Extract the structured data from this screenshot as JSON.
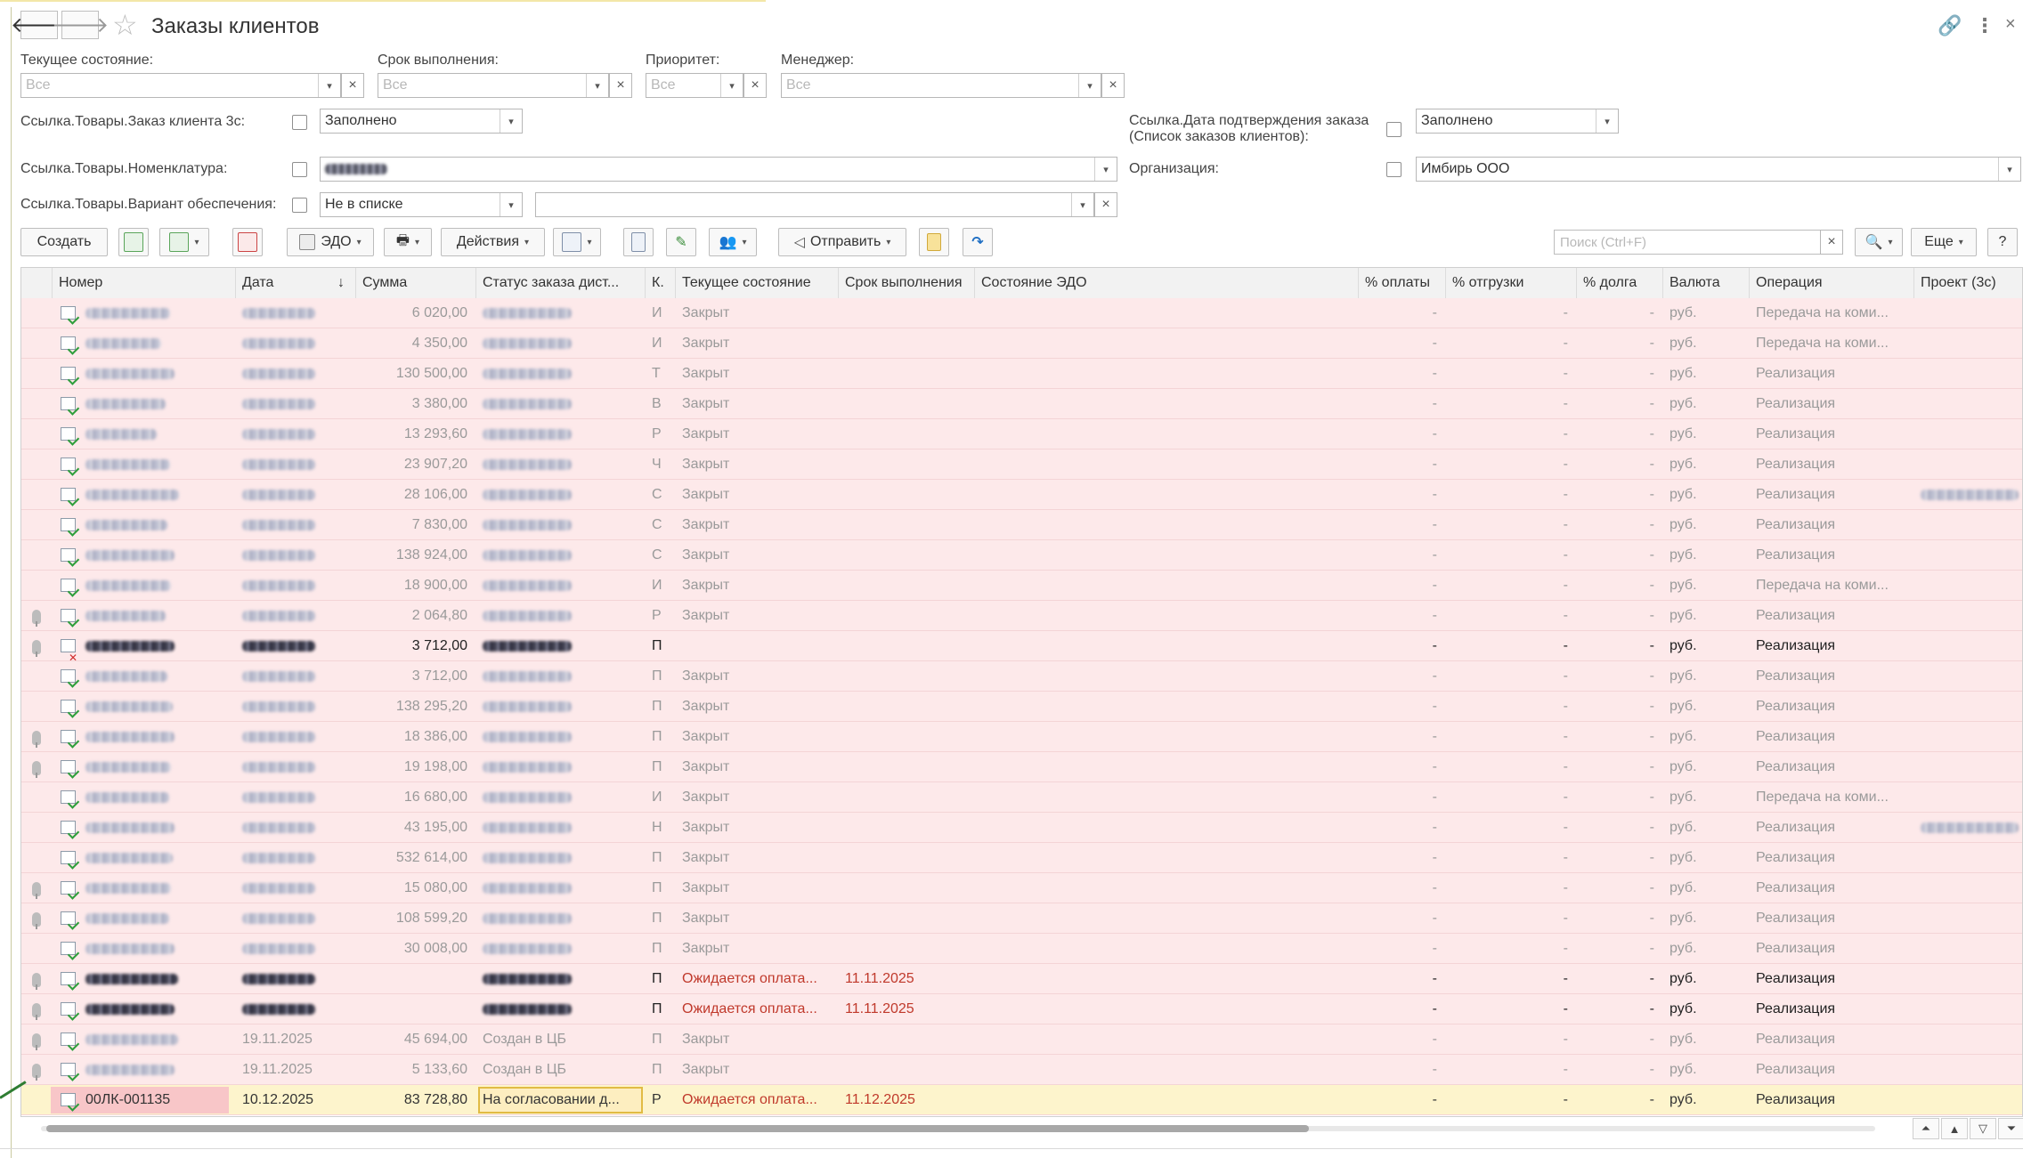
{
  "window": {
    "title": "Заказы клиентов",
    "back_icon": "arrow-left-icon",
    "forward_icon": "arrow-right-icon",
    "favorite_icon": "star-icon",
    "link_icon": "link-icon",
    "menu_icon": "more-vertical-icon",
    "close_label": "×"
  },
  "filters": {
    "current_state": {
      "label": "Текущее состояние:",
      "placeholder": "Все"
    },
    "deadline": {
      "label": "Срок выполнения:",
      "placeholder": "Все"
    },
    "priority": {
      "label": "Приоритет:",
      "placeholder": "Все"
    },
    "manager": {
      "label": "Менеджер:",
      "placeholder": "Все"
    },
    "order3c": {
      "label": "Ссылка.Товары.Заказ клиента 3с:",
      "value": "Заполнено"
    },
    "confirm_date": {
      "label_line1": "Ссылка.Дата подтверждения заказа",
      "label_line2": "(Список заказов клиентов):",
      "value": "Заполнено"
    },
    "nomenclature": {
      "label": "Ссылка.Товары.Номенклатура:"
    },
    "organization": {
      "label": "Организация:",
      "value": "Имбирь ООО"
    },
    "variant": {
      "label": "Ссылка.Товары.Вариант обеспечения:",
      "value": "Не в списке"
    },
    "clear_label": "×"
  },
  "toolbar": {
    "create": "Создать",
    "edo": "ЭДО",
    "actions": "Действия",
    "send": "Отправить",
    "search_placeholder": "Поиск (Ctrl+F)",
    "more": "Еще",
    "help": "?",
    "sort_arrow": "↓",
    "clear_label": "×"
  },
  "table": {
    "columns": [
      "Номер",
      "Дата",
      "Сумма",
      "Статус заказа дист...",
      "К.",
      "Текущее состояние",
      "Срок выполнения",
      "Состояние ЭДО",
      "% оплаты",
      "% отгрузки",
      "% долга",
      "Валюта",
      "Операция",
      "Проект (3с)"
    ],
    "rows": [
      {
        "sum": "6 020,00",
        "k": "И",
        "state": "Закрыт",
        "deadline": "",
        "op": "Передача на коми...",
        "style": "dim",
        "pin": false,
        "icon": "doc-check",
        "project": false
      },
      {
        "sum": "4 350,00",
        "k": "И",
        "state": "Закрыт",
        "deadline": "",
        "op": "Передача на коми...",
        "style": "dim",
        "pin": false,
        "icon": "doc-check",
        "project": false
      },
      {
        "sum": "130 500,00",
        "k": "Т",
        "state": "Закрыт",
        "deadline": "",
        "op": "Реализация",
        "style": "dim",
        "pin": false,
        "icon": "doc-check",
        "project": false
      },
      {
        "sum": "3 380,00",
        "k": "В",
        "state": "Закрыт",
        "deadline": "",
        "op": "Реализация",
        "style": "dim",
        "pin": false,
        "icon": "doc-check",
        "project": false
      },
      {
        "sum": "13 293,60",
        "k": "Р",
        "state": "Закрыт",
        "deadline": "",
        "op": "Реализация",
        "style": "dim",
        "pin": false,
        "icon": "doc-check",
        "project": false
      },
      {
        "sum": "23 907,20",
        "k": "Ч",
        "state": "Закрыт",
        "deadline": "",
        "op": "Реализация",
        "style": "dim",
        "pin": false,
        "icon": "doc-check",
        "project": false
      },
      {
        "sum": "28 106,00",
        "k": "С",
        "state": "Закрыт",
        "deadline": "",
        "op": "Реализация",
        "style": "dim",
        "pin": false,
        "icon": "doc-check",
        "project": true
      },
      {
        "sum": "7 830,00",
        "k": "С",
        "state": "Закрыт",
        "deadline": "",
        "op": "Реализация",
        "style": "dim",
        "pin": false,
        "icon": "doc-check",
        "project": false
      },
      {
        "sum": "138 924,00",
        "k": "С",
        "state": "Закрыт",
        "deadline": "",
        "op": "Реализация",
        "style": "dim",
        "pin": false,
        "icon": "doc-check",
        "project": false
      },
      {
        "sum": "18 900,00",
        "k": "И",
        "state": "Закрыт",
        "deadline": "",
        "op": "Передача на коми...",
        "style": "dim",
        "pin": false,
        "icon": "doc-check",
        "project": false
      },
      {
        "sum": "2 064,80",
        "k": "Р",
        "state": "Закрыт",
        "deadline": "",
        "op": "Реализация",
        "style": "dim",
        "pin": true,
        "icon": "doc-check",
        "project": false
      },
      {
        "sum": "3 712,00",
        "k": "П",
        "state": "",
        "deadline": "",
        "op": "Реализация",
        "style": "bold",
        "pin": true,
        "icon": "doc-x",
        "project": false
      },
      {
        "sum": "3 712,00",
        "k": "П",
        "state": "Закрыт",
        "deadline": "",
        "op": "Реализация",
        "style": "dim",
        "pin": false,
        "icon": "doc-check",
        "project": false
      },
      {
        "sum": "138 295,20",
        "k": "П",
        "state": "Закрыт",
        "deadline": "",
        "op": "Реализация",
        "style": "dim",
        "pin": false,
        "icon": "doc-check",
        "project": false
      },
      {
        "sum": "18 386,00",
        "k": "П",
        "state": "Закрыт",
        "deadline": "",
        "op": "Реализация",
        "style": "dim",
        "pin": true,
        "icon": "doc-check",
        "project": false
      },
      {
        "sum": "19 198,00",
        "k": "П",
        "state": "Закрыт",
        "deadline": "",
        "op": "Реализация",
        "style": "dim",
        "pin": true,
        "icon": "doc-check",
        "project": false
      },
      {
        "sum": "16 680,00",
        "k": "И",
        "state": "Закрыт",
        "deadline": "",
        "op": "Передача на коми...",
        "style": "dim",
        "pin": false,
        "icon": "doc-check",
        "project": false
      },
      {
        "sum": "43 195,00",
        "k": "Н",
        "state": "Закрыт",
        "deadline": "",
        "op": "Реализация",
        "style": "dim",
        "pin": false,
        "icon": "doc-check",
        "project": true
      },
      {
        "sum": "532 614,00",
        "k": "П",
        "state": "Закрыт",
        "deadline": "",
        "op": "Реализация",
        "style": "dim",
        "pin": false,
        "icon": "doc-check",
        "project": false
      },
      {
        "sum": "15 080,00",
        "k": "П",
        "state": "Закрыт",
        "deadline": "",
        "op": "Реализация",
        "style": "dim",
        "pin": true,
        "icon": "doc-check",
        "project": false
      },
      {
        "sum": "108 599,20",
        "k": "П",
        "state": "Закрыт",
        "deadline": "",
        "op": "Реализация",
        "style": "dim",
        "pin": true,
        "icon": "doc-check",
        "project": false
      },
      {
        "sum": "30 008,00",
        "k": "П",
        "state": "Закрыт",
        "deadline": "",
        "op": "Реализация",
        "style": "dim",
        "pin": false,
        "icon": "doc-check",
        "project": false
      },
      {
        "sum": "",
        "k": "П",
        "state": "Ожидается оплата...",
        "deadline": "11.11.2025",
        "op": "Реализация",
        "style": "bold",
        "pin": true,
        "icon": "doc-check",
        "project": false
      },
      {
        "sum": "",
        "k": "П",
        "state": "Ожидается оплата...",
        "deadline": "11.11.2025",
        "op": "Реализация",
        "style": "bold",
        "pin": true,
        "icon": "doc-check",
        "project": false
      },
      {
        "sum": "45 694,00",
        "k": "П",
        "state": "Закрыт",
        "deadline": "",
        "op": "Реализация",
        "style": "dim",
        "pin": true,
        "icon": "doc-check",
        "project": false,
        "date": "19.11.2025",
        "status": "Создан в ЦБ"
      },
      {
        "sum": "5 133,60",
        "k": "П",
        "state": "Закрыт",
        "deadline": "",
        "op": "Реализация",
        "style": "dim",
        "pin": true,
        "icon": "doc-check",
        "project": false,
        "date": "19.11.2025",
        "status": "Создан в ЦБ"
      },
      {
        "sum": "83 728,80",
        "k": "Р",
        "state": "Ожидается оплата...",
        "deadline": "11.12.2025",
        "op": "Реализация",
        "style": "sel",
        "pin": false,
        "icon": "doc-check",
        "project": false,
        "number": "00ЛК-001135",
        "date": "10.12.2025",
        "status": "На согласовании д..."
      }
    ],
    "dash": "-",
    "currency": "руб."
  },
  "colors": {
    "row_bg": "#fde9ea",
    "selected_row_bg": "#fdf4cc",
    "alert_text": "#c0392b"
  }
}
